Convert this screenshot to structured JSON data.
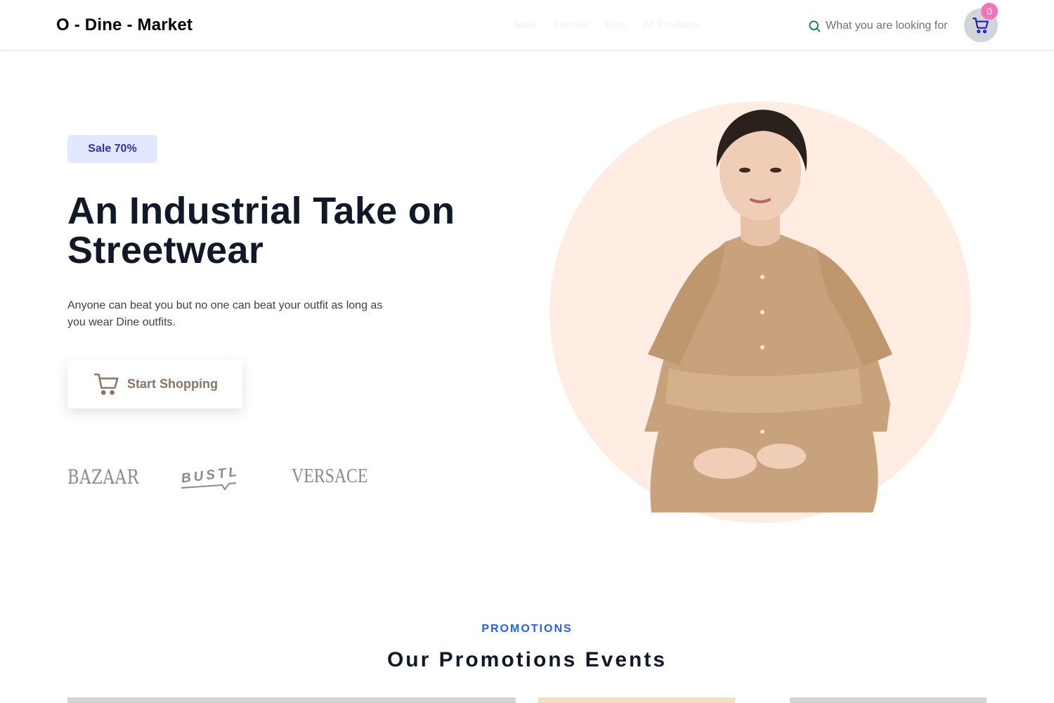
{
  "header": {
    "logo": "O - Dine - Market",
    "nav": [
      {
        "label": "Male"
      },
      {
        "label": "Female"
      },
      {
        "label": "Kids"
      },
      {
        "label": "All Products"
      }
    ],
    "search_placeholder": "What you are looking for",
    "cart_count": "0"
  },
  "hero": {
    "badge": "Sale 70%",
    "title": "An Industrial Take on Streetwear",
    "description": "Anyone can beat you but no one can beat your outfit as long as you wear Dine outfits.",
    "cta": "Start Shopping",
    "brands": [
      "BAZAAR",
      "BUSTLE",
      "VERSACE"
    ]
  },
  "promotions": {
    "kicker": "PROMOTIONS",
    "title": "Our Promotions Events"
  },
  "colors": {
    "accent": "#2563eb",
    "badge_bg": "#e1e8ff",
    "badge_text": "#3730a3",
    "hero_circle": "#ffece3",
    "cart_badge": "#f472b6"
  },
  "icons": {
    "search": "search-icon",
    "cart": "cart-icon"
  }
}
